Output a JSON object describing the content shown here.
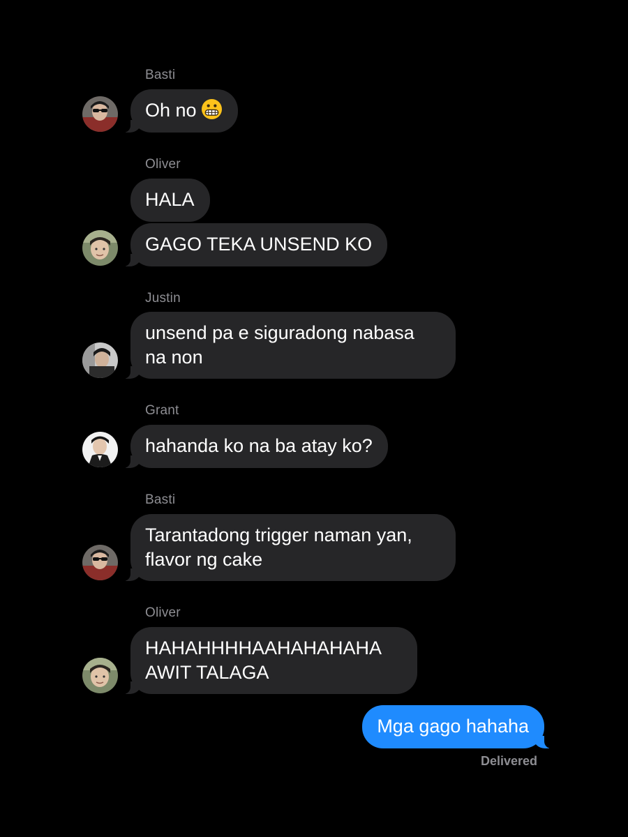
{
  "messages": [
    {
      "sender": "Basti",
      "lines": [
        "Oh no"
      ],
      "emoji": "grimacing-face-emoji"
    },
    {
      "sender": "Oliver",
      "lines": [
        "HALA"
      ]
    },
    {
      "lines": [
        "GAGO TEKA UNSEND KO"
      ]
    },
    {
      "sender": "Justin",
      "lines": [
        "unsend pa e siguradong nabasa",
        "na non"
      ]
    },
    {
      "sender": "Grant",
      "lines": [
        "hahanda ko na ba atay ko?"
      ]
    },
    {
      "sender": "Basti",
      "lines": [
        "Tarantadong trigger naman yan,",
        "flavor ng cake"
      ]
    },
    {
      "sender": "Oliver",
      "lines": [
        "HAHAHHHHAAHAHAHAHA",
        "AWIT TALAGA"
      ]
    },
    {
      "lines": [
        "Mga gago hahaha"
      ],
      "outgoing": true
    }
  ],
  "status": "Delivered",
  "colors": {
    "background": "#000000",
    "incoming_bubble": "#262628",
    "outgoing_bubble": "#1f8bfe",
    "secondary_text": "#8e8e93"
  }
}
